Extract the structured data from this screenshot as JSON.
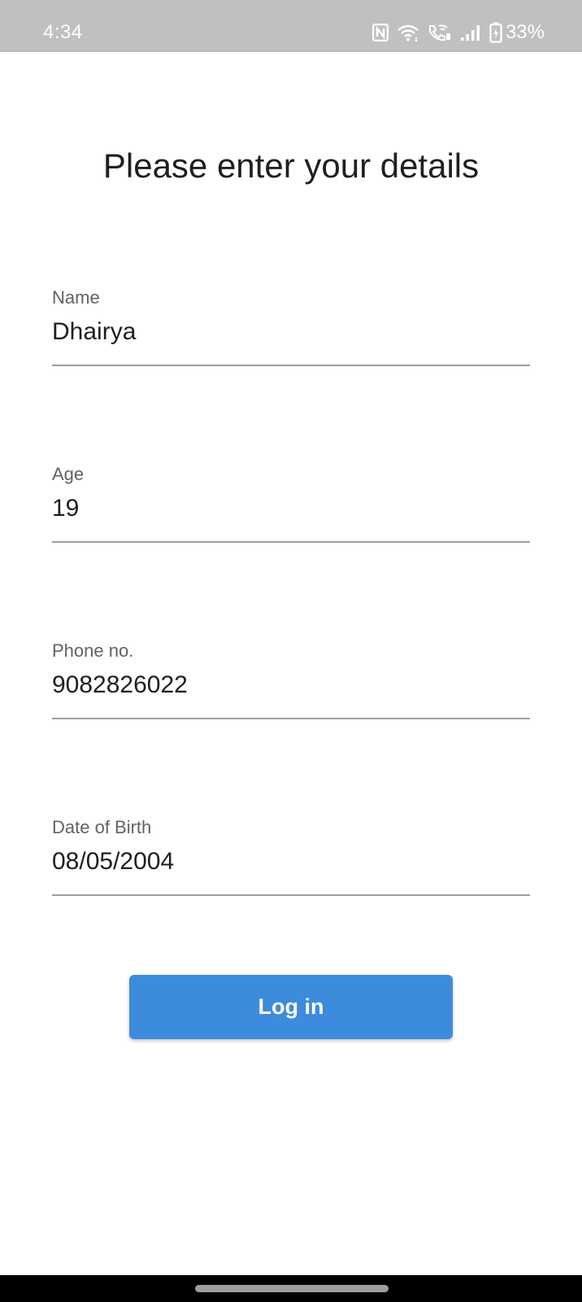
{
  "status_bar": {
    "time": "4:34",
    "battery": "33%",
    "icons": [
      "nfc-icon",
      "wifi-icon",
      "wifi-calling-icon",
      "signal-icon",
      "battery-charging-icon"
    ]
  },
  "form": {
    "title": "Please enter your details",
    "fields": [
      {
        "label": "Name",
        "value": "Dhairya"
      },
      {
        "label": "Age",
        "value": "19"
      },
      {
        "label": "Phone no.",
        "value": "9082826022"
      },
      {
        "label": "Date of Birth",
        "value": "08/05/2004"
      }
    ],
    "submit_label": "Log in"
  },
  "colors": {
    "status_bar_bg": "#c0c0c0",
    "button_bg": "#3d8bdc",
    "underline": "#9e9e9e",
    "label": "#5f6368"
  }
}
